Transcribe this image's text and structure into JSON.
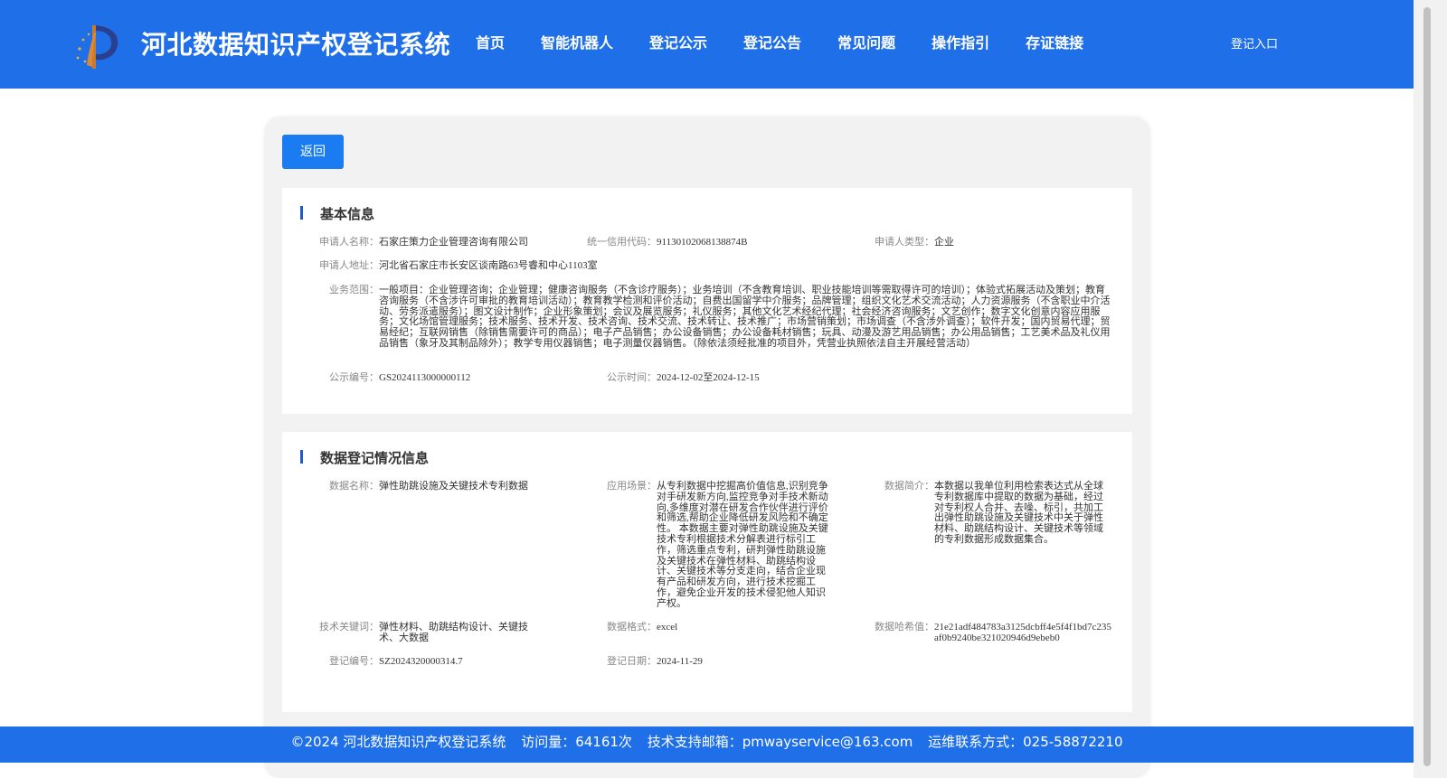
{
  "header": {
    "site_title": "河北数据知识产权登记系统",
    "nav": [
      "首页",
      "智能机器人",
      "登记公示",
      "登记公告",
      "常见问题",
      "操作指引",
      "存证链接"
    ],
    "login": "登记入口"
  },
  "back_button": "返回",
  "basic_info": {
    "title": "基本信息",
    "applicant_name": {
      "label": "申请人名称：",
      "value": "石家庄策力企业管理咨询有限公司"
    },
    "credit_code": {
      "label": "统一信用代码：",
      "value": "91130102068138874B"
    },
    "applicant_type": {
      "label": "申请人类型：",
      "value": "企业"
    },
    "address": {
      "label": "申请人地址：",
      "value": "河北省石家庄市长安区谈南路63号睿和中心1103室"
    },
    "business_scope": {
      "label": "业务范围：",
      "value": "一般项目：企业管理咨询；企业管理；健康咨询服务（不含诊疗服务）；业务培训（不含教育培训、职业技能培训等需取得许可的培训）；体验式拓展活动及策划；教育咨询服务（不含涉许可审批的教育培训活动）；教育教学检测和评价活动；自费出国留学中介服务；品牌管理；组织文化艺术交流活动；人力资源服务（不含职业中介活动、劳务派遣服务）；图文设计制作；企业形象策划；会议及展览服务；礼仪服务；其他文化艺术经纪代理；社会经济咨询服务；文艺创作；数字文化创意内容应用服务；文化场馆管理服务；技术服务、技术开发、技术咨询、技术交流、技术转让、技术推广；市场营销策划；市场调查（不含涉外调查）；软件开发；国内贸易代理；贸易经纪；互联网销售（除销售需要许可的商品）；电子产品销售；办公设备销售；办公设备耗材销售；玩具、动漫及游艺用品销售；办公用品销售；工艺美术品及礼仪用品销售（象牙及其制品除外）；教学专用仪器销售；电子测量仪器销售。（除依法须经批准的项目外，凭营业执照依法自主开展经营活动）"
    },
    "publicity_no": {
      "label": "公示编号：",
      "value": "GS2024113000000112"
    },
    "publicity_time": {
      "label": "公示时间：",
      "value": "2024-12-02至2024-12-15"
    }
  },
  "data_info": {
    "title": "数据登记情况信息",
    "data_name": {
      "label": "数据名称：",
      "value": "弹性助跳设施及关键技术专利数据"
    },
    "scenario": {
      "label": "应用场景：",
      "value": "从专利数据中挖掘高价值信息,识别竞争对手研发新方向,监控竞争对手技术新动向,多维度对潜在研发合作伙伴进行评价和筛选,帮助企业降低研发风险和不确定性。 本数据主要对弹性助跳设施及关键技术专利根据技术分解表进行标引工作，筛选重点专利，研判弹性助跳设施及关键技术在弹性材料、助跳结构设计、关键技术等分支走向，结合企业现有产品和研发方向，进行技术挖掘工作，避免企业开发的技术侵犯他人知识产权。"
    },
    "summary": {
      "label": "数据简介：",
      "value": "本数据以我单位利用检索表达式从全球专利数据库中提取的数据为基础，经过对专利权人合并、去噪、标引，共加工出弹性助跳设施及关键技术中关于弹性材料、助跳结构设计、关键技术等领域的专利数据形成数据集合。"
    },
    "keywords": {
      "label": "技术关键词：",
      "value": "弹性材料、助跳结构设计、关键技术、大数据"
    },
    "format": {
      "label": "数据格式：",
      "value": "excel"
    },
    "hash": {
      "label": "数据哈希值：",
      "value": "21e21adf484783a3125dcbff4e5f4f1bd7c235af0b9240be321020946d9ebeb0"
    },
    "reg_no": {
      "label": "登记编号：",
      "value": "SZ2024320000314.7"
    },
    "reg_date": {
      "label": "登记日期：",
      "value": "2024-11-29"
    }
  },
  "footer": {
    "copyright": "©2024 河北数据知识产权登记系统",
    "visits": "访问量：64161次",
    "email": "技术支持邮箱：pmwayservice@163.com",
    "phone": "运维联系方式：025-58872210"
  }
}
